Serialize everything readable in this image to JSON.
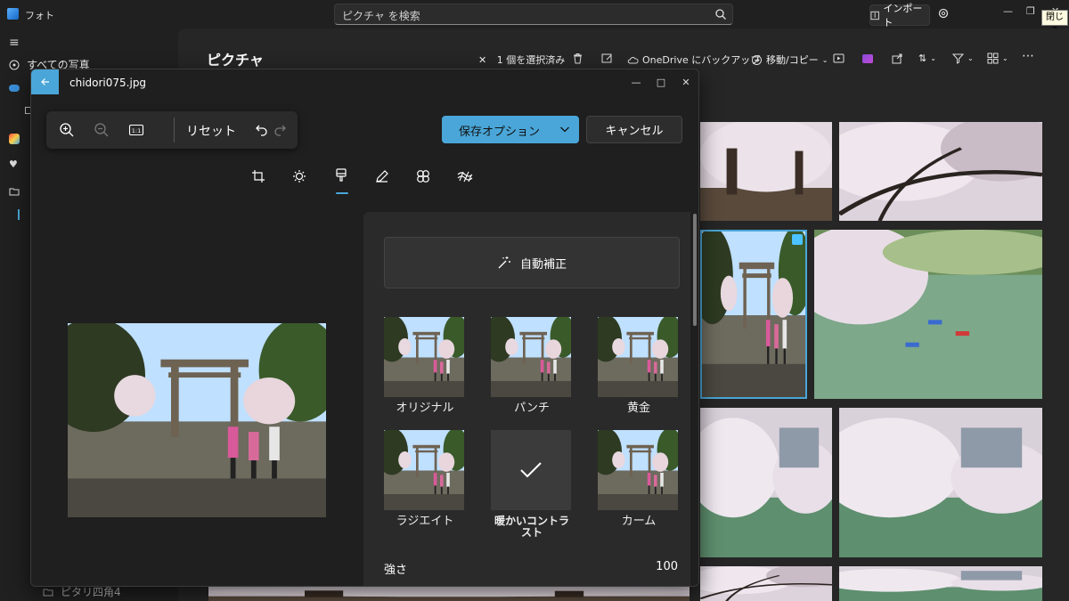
{
  "app": {
    "title": "フォト",
    "search_placeholder": "ピクチャ を検索",
    "import_label": "インポート",
    "close_tooltip": "閉じる"
  },
  "sidebar": {
    "items": [
      {
        "label": "すべての写真",
        "icon": "photos-icon"
      },
      {
        "label": "ピタリ四角4",
        "icon": "folder-icon"
      }
    ]
  },
  "gallery": {
    "title": "ピクチャ",
    "toolbar": {
      "selection_label": "1 個を選択済み",
      "onedrive_label": "OneDrive にバックアップ",
      "move_label": "移動/コピー"
    }
  },
  "editor": {
    "filename": "chidori075.jpg",
    "reset_label": "リセット",
    "save_label": "保存オプション",
    "cancel_label": "キャンセル",
    "auto_enhance_label": "自動補正",
    "filters": [
      {
        "label": "オリジナル",
        "selected": false
      },
      {
        "label": "パンチ",
        "selected": false
      },
      {
        "label": "黄金",
        "selected": false
      },
      {
        "label": "ラジエイト",
        "selected": false
      },
      {
        "label": "暖かいコントラスト",
        "selected": true
      },
      {
        "label": "カーム",
        "selected": false
      }
    ],
    "strength_label": "強さ",
    "strength_value": "100"
  },
  "colors": {
    "accent": "#4aa6d8",
    "background": "#202020",
    "panel": "#2a2a2a"
  }
}
